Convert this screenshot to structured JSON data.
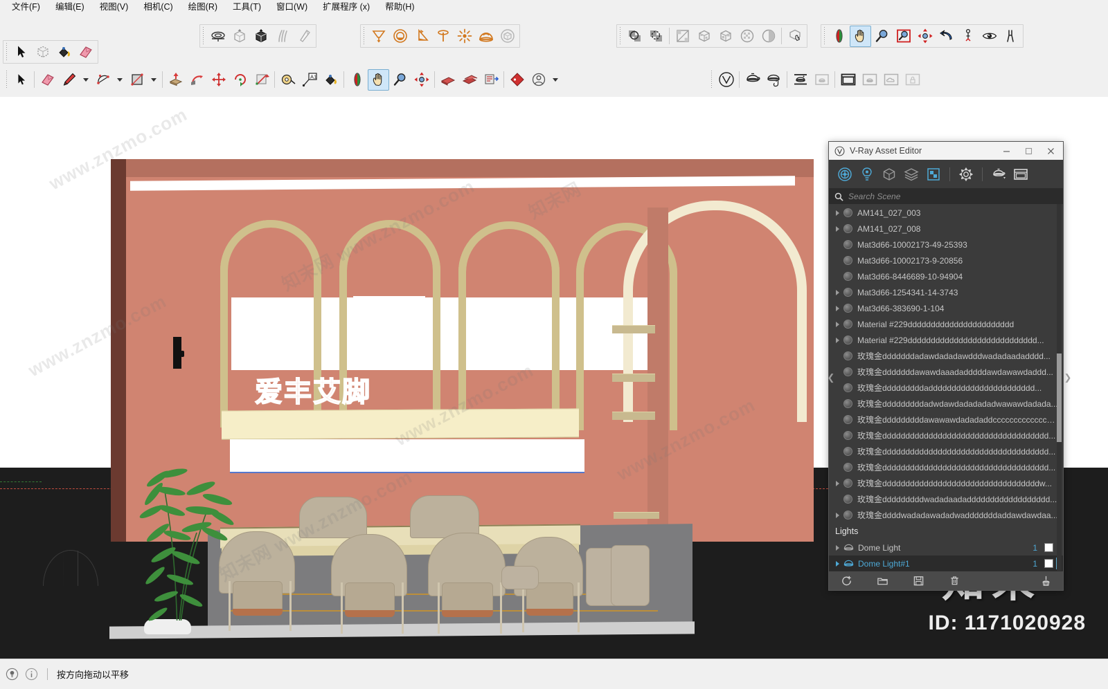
{
  "app": {
    "title": "SketchUp",
    "menu": [
      {
        "label": "文件(F)",
        "name": "menu-file"
      },
      {
        "label": "编辑(E)",
        "name": "menu-edit"
      },
      {
        "label": "视图(V)",
        "name": "menu-view"
      },
      {
        "label": "相机(C)",
        "name": "menu-camera"
      },
      {
        "label": "绘图(R)",
        "name": "menu-draw"
      },
      {
        "label": "工具(T)",
        "name": "menu-tools"
      },
      {
        "label": "窗口(W)",
        "name": "menu-window"
      },
      {
        "label": "扩展程序 (x)",
        "name": "menu-extensions"
      },
      {
        "label": "帮助(H)",
        "name": "menu-help"
      }
    ]
  },
  "toolbars": {
    "sandbox": [
      "from-contours-icon",
      "from-scratch-icon",
      "smoove-icon",
      "stamp-icon",
      "drape-icon"
    ],
    "vray_lights": [
      "rectangle-light-icon",
      "sphere-light-icon",
      "spot-light-icon",
      "ies-light-icon",
      "omni-light-icon",
      "dome-light-icon",
      "mesh-light-icon"
    ],
    "principal_top": [
      "select-icon",
      "make-component-icon",
      "paint-bucket-icon",
      "eraser-icon"
    ],
    "drawing": [
      "select-icon",
      "eraser-icon",
      "pencil-icon",
      "arc-icon",
      "rectangle-icon",
      "pushpull-icon",
      "follow-me-icon",
      "move-icon",
      "rotate-icon",
      "scale-icon",
      "tape-measure-icon",
      "text-icon",
      "paint-bucket-icon",
      "orbit-icon",
      "pan-icon",
      "zoom-icon",
      "zoom-extents-icon",
      "section-plane-icon",
      "scenes-icon",
      "layers-icon",
      "tag-icon",
      "account-icon"
    ],
    "styles": [
      "xray-icon",
      "back-edges-icon",
      "wireframe-icon",
      "hidden-line-icon",
      "shaded-icon",
      "shaded-texture-icon",
      "monochrome-icon",
      "face-style-icon"
    ],
    "camera": [
      "orbit-icon",
      "pan-icon",
      "zoom-icon",
      "zoom-window-icon",
      "zoom-extents-icon",
      "previous-view-icon",
      "position-camera-icon",
      "look-around-icon",
      "walk-icon"
    ],
    "vray_render": [
      "vray-logo-icon",
      "render-icon",
      "render-interactive-icon",
      "render-region-icon",
      "render-last-icon",
      "frame-buffer-icon",
      "asset-editor-icon",
      "cloud-icon",
      "lock-icon"
    ],
    "active_tool": "pan-icon"
  },
  "viewport": {
    "signage_text": "爱丰艾脚",
    "scene_colors": {
      "wall": "#d08471",
      "wall_frame": "#6b3a30",
      "arch_trim": "#cfc08c",
      "cream_beam": "#f6eec8",
      "floor": "#7c7c7e",
      "chair": "#bcb19c",
      "ground": "#1d1d1d",
      "red_axis": "#e05646",
      "green_axis": "#3fa33f"
    }
  },
  "asset_editor": {
    "title": "V-Ray Asset Editor",
    "window_buttons": {
      "minimize": "minimize-icon",
      "maximize": "maximize-icon",
      "close": "close-icon"
    },
    "tabs": [
      {
        "name": "materials-tab",
        "icon": "material-sphere-icon",
        "active": true
      },
      {
        "name": "lights-tab",
        "icon": "light-bulb-icon",
        "active": false
      },
      {
        "name": "geometry-tab",
        "icon": "geometry-cube-icon",
        "active": false
      },
      {
        "name": "textures-tab",
        "icon": "layers-icon",
        "active": false
      },
      {
        "name": "render-elements-tab",
        "icon": "render-element-icon",
        "active": false
      },
      {
        "name": "settings-tab",
        "icon": "gear-icon",
        "active": false
      },
      {
        "name": "render-tab",
        "icon": "teapot-icon",
        "active": false
      },
      {
        "name": "frame-buffer-tab",
        "icon": "frame-buffer-icon",
        "active": false
      }
    ],
    "search": {
      "placeholder": "Search Scene",
      "value": "",
      "icon": "search-icon"
    },
    "materials": [
      {
        "label": "AM141_027_003",
        "expandable": true,
        "selected": false
      },
      {
        "label": "AM141_027_008",
        "expandable": true,
        "selected": false
      },
      {
        "label": "Mat3d66-10002173-49-25393",
        "expandable": false,
        "selected": false
      },
      {
        "label": "Mat3d66-10002173-9-20856",
        "expandable": false,
        "selected": false
      },
      {
        "label": "Mat3d66-8446689-10-94904",
        "expandable": false,
        "selected": false
      },
      {
        "label": "Mat3d66-1254341-14-3743",
        "expandable": true,
        "selected": false
      },
      {
        "label": "Mat3d66-383690-1-104",
        "expandable": true,
        "selected": false
      },
      {
        "label": "Material #229ddddddddddddddddddddddd",
        "expandable": true,
        "selected": false
      },
      {
        "label": "Material #229dddddddddddddddddddddddddddd...",
        "expandable": true,
        "selected": false
      },
      {
        "label": "玫瑰金dddddddadawdadadawdddwadadaadadddd...",
        "expandable": false,
        "selected": false
      },
      {
        "label": "玫瑰金dddddddawawdaaadadddddawdawawdaddd...",
        "expandable": false,
        "selected": false
      },
      {
        "label": "玫瑰金dddddddddaddddddddddddddddddddddd...",
        "expandable": false,
        "selected": false
      },
      {
        "label": "玫瑰金dddddddddadwdawdadadadadwawawdadada...",
        "expandable": false,
        "selected": false
      },
      {
        "label": "玫瑰金dddddddddawawawdadadaddcccccccccccccccc...",
        "expandable": false,
        "selected": false
      },
      {
        "label": "玫瑰金dddddddddddddddddddddddddddddddddddd...",
        "expandable": false,
        "selected": false
      },
      {
        "label": "玫瑰金dddddddddddddddddddddddddddddddddddd...",
        "expandable": false,
        "selected": false
      },
      {
        "label": "玫瑰金dddddddddddddddddddddddddddddddddddd...",
        "expandable": false,
        "selected": false
      },
      {
        "label": "玫瑰金ddddddddddddddddddddddddddddddddddw...",
        "expandable": true,
        "selected": false
      },
      {
        "label": "玫瑰金dddddddddwadadaadadddddddddddddddddd...",
        "expandable": false,
        "selected": false
      },
      {
        "label": "玫瑰金ddddwadadawadadwadddddddaddawdawdaa...",
        "expandable": true,
        "selected": false
      }
    ],
    "lights_section_label": "Lights",
    "lights": [
      {
        "label": "Dome Light",
        "count": "1",
        "selected": false,
        "icon": "dome-light-icon"
      },
      {
        "label": "Dome Light#1",
        "count": "1",
        "selected": true,
        "icon": "dome-light-icon"
      }
    ],
    "footer_buttons": [
      {
        "name": "add-asset-button",
        "icon": "add-asset-icon"
      },
      {
        "name": "open-asset-button",
        "icon": "folder-icon"
      },
      {
        "name": "save-asset-button",
        "icon": "save-disk-icon"
      },
      {
        "name": "delete-asset-button",
        "icon": "trash-icon"
      },
      {
        "name": "purge-assets-button",
        "icon": "broom-icon"
      }
    ]
  },
  "watermarks": {
    "tiles": [
      "www.znzmo.com",
      "知末网 www.znzmo.com",
      "www.znzmo.com",
      "知末网"
    ],
    "brand": "知末",
    "id": "ID: 1171020928"
  },
  "statusbar": {
    "hint": "按方向拖动以平移",
    "icons": [
      "info-bulb-icon",
      "info-circle-icon"
    ]
  }
}
